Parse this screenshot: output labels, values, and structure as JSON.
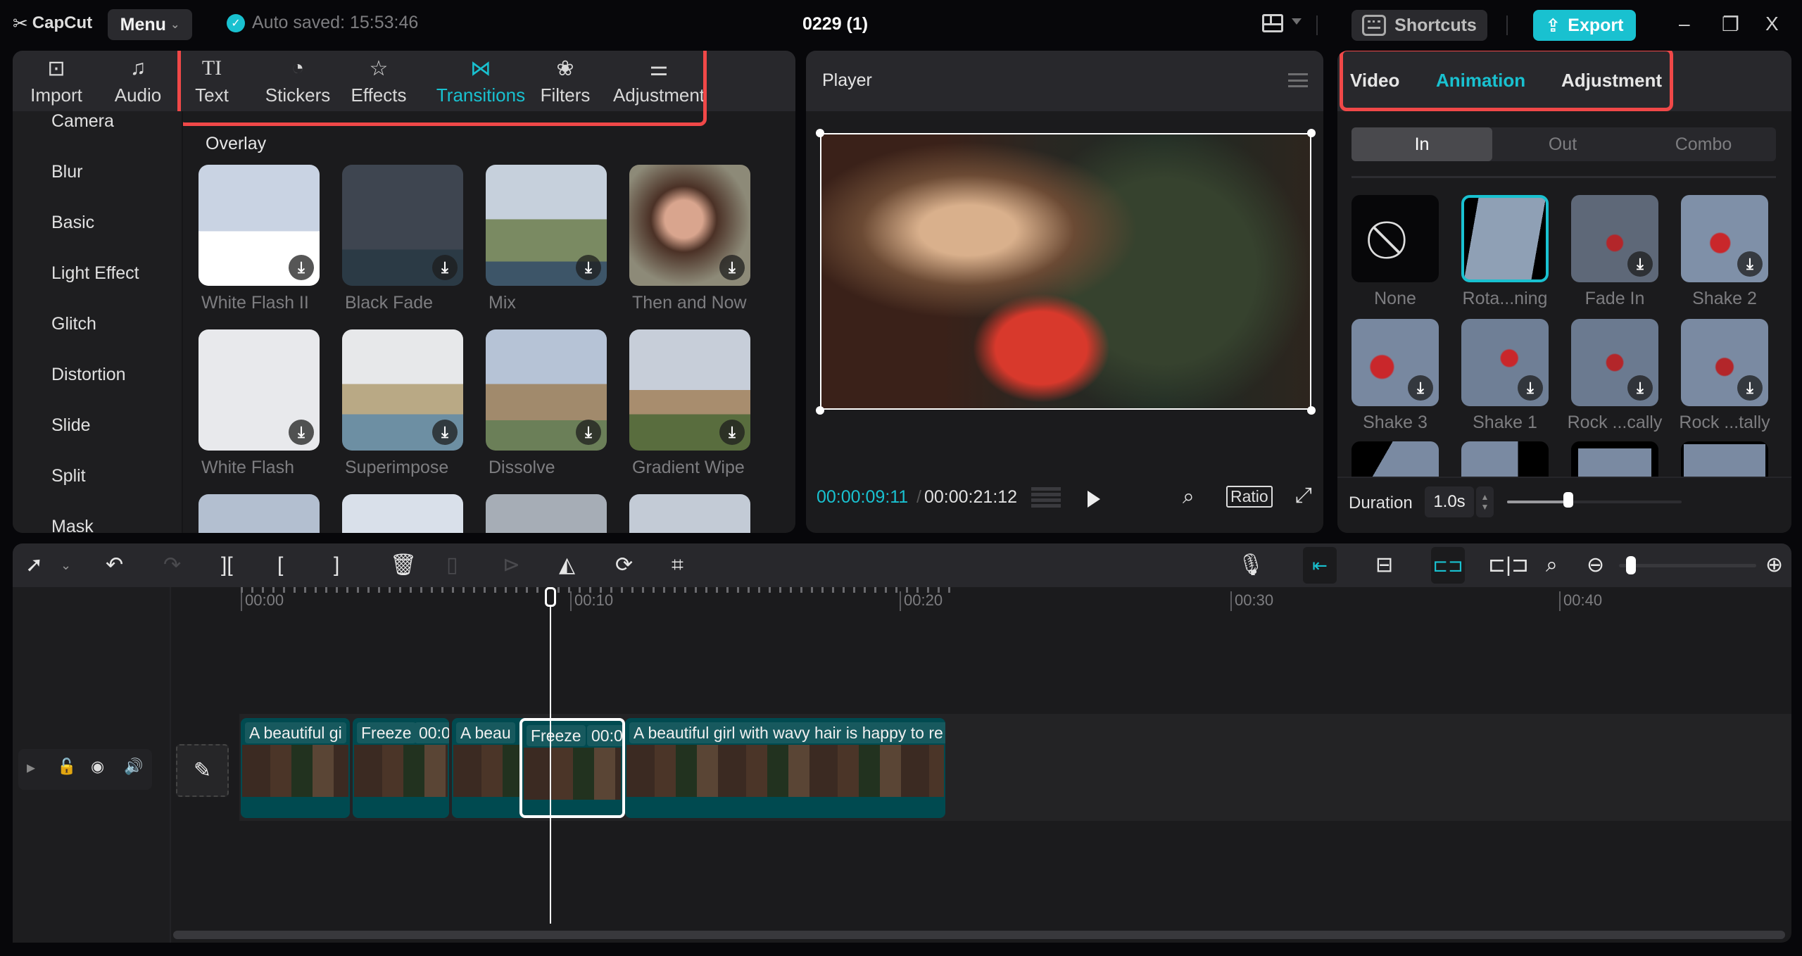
{
  "app": {
    "name": "CapCut",
    "menu_label": "Menu",
    "autosave_text": "Auto saved: 15:53:46",
    "project_title": "0229 (1)"
  },
  "topbar": {
    "shortcuts_label": "Shortcuts",
    "export_label": "Export",
    "minimize": "–",
    "maximize": "❐",
    "close": "X"
  },
  "left_panel": {
    "tabs": [
      {
        "label": "Import",
        "icon": "import-icon"
      },
      {
        "label": "Audio",
        "icon": "audio-icon"
      },
      {
        "label": "Text",
        "icon": "text-icon"
      },
      {
        "label": "Stickers",
        "icon": "sticker-icon"
      },
      {
        "label": "Effects",
        "icon": "effects-icon"
      },
      {
        "label": "Transitions",
        "icon": "transition-icon",
        "active": true
      },
      {
        "label": "Filters",
        "icon": "filters-icon"
      },
      {
        "label": "Adjustment",
        "icon": "adjustment-icon"
      }
    ],
    "categories": [
      "Camera",
      "Blur",
      "Basic",
      "Light Effect",
      "Glitch",
      "Distortion",
      "Slide",
      "Split",
      "Mask"
    ],
    "section_title": "Overlay",
    "items": [
      {
        "label": "White Flash II"
      },
      {
        "label": "Black Fade"
      },
      {
        "label": "Mix"
      },
      {
        "label": "Then and Now"
      },
      {
        "label": "White Flash"
      },
      {
        "label": "Superimpose"
      },
      {
        "label": "Dissolve"
      },
      {
        "label": "Gradient Wipe"
      }
    ]
  },
  "player": {
    "title": "Player",
    "current_time": "00:00:09:11",
    "separator": "/",
    "total_time": "00:00:21:12",
    "ratio_label": "Ratio"
  },
  "right_panel": {
    "tabs": [
      {
        "label": "Video"
      },
      {
        "label": "Animation",
        "active": true
      },
      {
        "label": "Adjustment"
      }
    ],
    "segments": [
      {
        "label": "In",
        "active": true
      },
      {
        "label": "Out"
      },
      {
        "label": "Combo"
      }
    ],
    "animations": [
      {
        "label": "None"
      },
      {
        "label": "Rota...ning",
        "selected": true
      },
      {
        "label": "Fade In"
      },
      {
        "label": "Shake 2"
      },
      {
        "label": "Shake 3"
      },
      {
        "label": "Shake 1"
      },
      {
        "label": "Rock ...cally"
      },
      {
        "label": "Rock ...tally"
      }
    ],
    "duration_label": "Duration",
    "duration_value": "1.0s",
    "duration_slider_fraction": 0.35
  },
  "timeline": {
    "ruler": [
      "00:00",
      "00:10",
      "00:20",
      "00:30",
      "00:40"
    ],
    "clips": [
      {
        "title": "A beautiful gi"
      },
      {
        "title": "Freeze",
        "time": "00:0"
      },
      {
        "title": "A beau"
      },
      {
        "title": "Freeze",
        "time": "00:0",
        "selected": true
      },
      {
        "title": "A beautiful girl with wavy hair is happy to re"
      }
    ],
    "zoom_fraction": 0.05
  }
}
